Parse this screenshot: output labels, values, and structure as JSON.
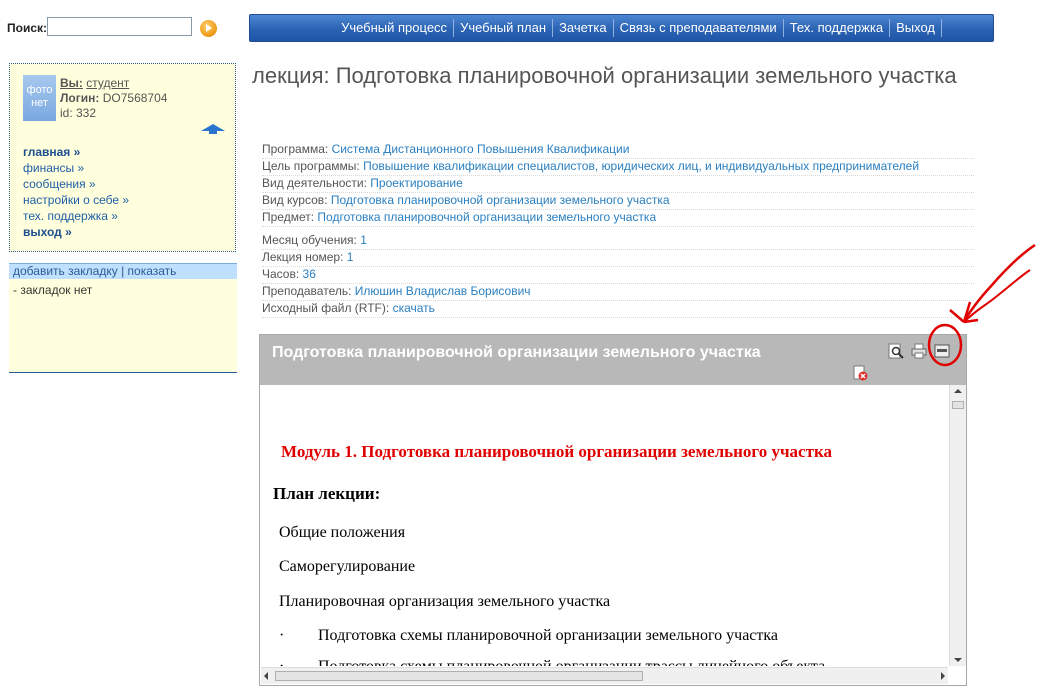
{
  "search": {
    "label": "Поиск:",
    "value": "",
    "placeholder": ""
  },
  "topnav": {
    "items": [
      "Учебный процесс",
      "Учебный план",
      "Зачетка",
      "Связь с преподавателями",
      "Тех. поддержка",
      "Выход"
    ],
    "color": "#2b63b4"
  },
  "user": {
    "avatar_text": "фото нет",
    "you_label": "Вы:",
    "you_value": "студент",
    "login_label": "Логин:",
    "login_value": "DO7568704",
    "id_text": "id: 332"
  },
  "user_menu": [
    "главная »",
    "финансы »",
    "сообщения »",
    "настройки о себе »",
    "тех. поддержка »",
    "выход »"
  ],
  "bookmarks": {
    "add": "добавить закладку",
    "separator": "|",
    "show": "показать",
    "empty": "- закладок нет"
  },
  "page": {
    "title": "лекция: Подготовка планировочной организации земельного участка"
  },
  "info": {
    "program_label": "Программа:",
    "program_value": "Система Дистанционного Повышения Квалификации",
    "goal_label": "Цель программы:",
    "goal_value": "Повышение квалификации специалистов, юридических лиц, и индивидуальных предпринимателей",
    "activity_label": "Вид деятельности:",
    "activity_value": "Проектирование",
    "course_label": "Вид курсов:",
    "course_value": "Подготовка планировочной организации земельного участка",
    "subject_label": "Предмет:",
    "subject_value": "Подготовка планировочной организации земельного участка",
    "month_label": "Месяц обучения:",
    "month_value": "1",
    "lecture_label": "Лекция номер:",
    "lecture_value": "1",
    "hours_label": "Часов:",
    "hours_value": "36",
    "teacher_label": "Преподаватель:",
    "teacher_value": "Илюшин Владислав Борисович",
    "file_label": "Исходный файл (RTF):",
    "file_value": "скачать"
  },
  "panel": {
    "title": "Подготовка планировочной организации земельного участка",
    "icons": [
      "search-icon",
      "print-icon",
      "maximize-icon",
      "close-icon"
    ]
  },
  "document": {
    "module": "Модуль 1. Подготовка планировочной организации земельного участка",
    "plan": "План лекции:",
    "items": [
      "Общие положения",
      "Саморегулирование",
      "Планировочная организация земельного участка"
    ],
    "bullet": "·",
    "bullet_items": [
      "Подготовка схемы планировочной организации земельного участка",
      "Подготовка схемы планировочной организации трассы линейного объекта"
    ]
  },
  "colors": {
    "link": "#2a7fc0",
    "module_title": "#e00000",
    "annotation": "#e00000"
  }
}
